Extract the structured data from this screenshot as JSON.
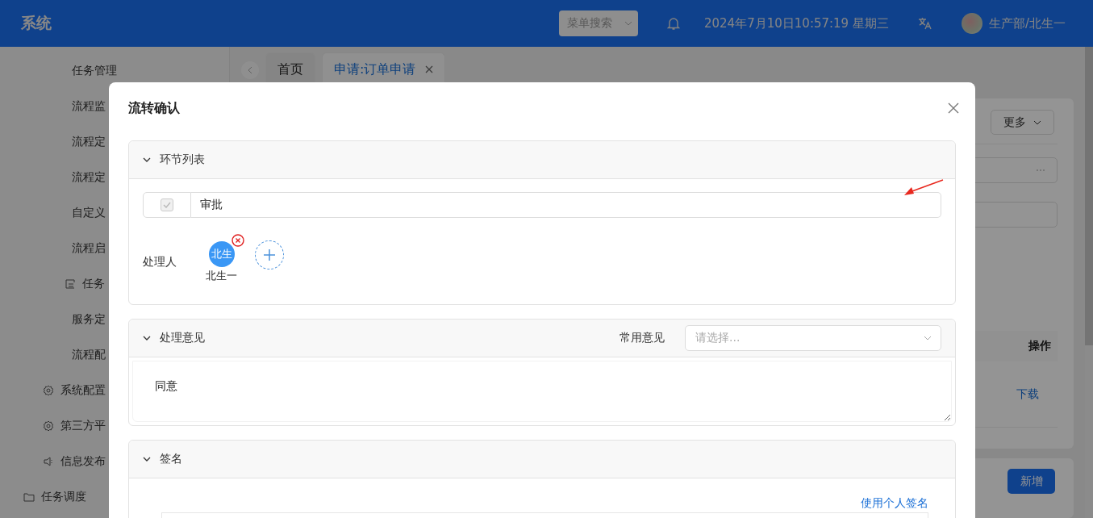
{
  "header": {
    "title": "系统",
    "menu_search": {
      "placeholder": "菜单搜索"
    },
    "datetime": "2024年7月10日10:57:19 星期三",
    "user": "生产部/北生一"
  },
  "sidebar": {
    "items": [
      {
        "label": "任务管理",
        "kind": "plain"
      },
      {
        "label": "流程监",
        "kind": "plain"
      },
      {
        "label": "流程定",
        "kind": "plain"
      },
      {
        "label": "流程定",
        "kind": "plain"
      },
      {
        "label": "自定义",
        "kind": "plain"
      },
      {
        "label": "流程启",
        "kind": "plain"
      },
      {
        "label": "任务",
        "kind": "list"
      },
      {
        "label": "服务定",
        "kind": "plain"
      },
      {
        "label": "流程配",
        "kind": "plain"
      },
      {
        "label": "系统配置",
        "kind": "gear"
      },
      {
        "label": "第三方平",
        "kind": "gear"
      },
      {
        "label": "信息发布",
        "kind": "speaker"
      },
      {
        "label": "任务调度",
        "kind": "folder"
      }
    ]
  },
  "tabs": [
    {
      "label": "首页",
      "selected": false,
      "closable": false
    },
    {
      "label": "申请:订单申请",
      "selected": true,
      "closable": true
    }
  ],
  "content": {
    "more_button": "更多",
    "table": {
      "action_header": "操作",
      "row_action": "下载"
    },
    "add_button": "新增"
  },
  "dialog": {
    "title": "流转确认",
    "sections": [
      {
        "kind": "steps",
        "title": "环节列表",
        "expanded": true,
        "steps": [
          {
            "label": "审批",
            "checked": true
          }
        ],
        "handler_label": "处理人",
        "handlers": [
          {
            "initials": "北生",
            "name": "北生一"
          }
        ]
      },
      {
        "kind": "opinion",
        "title": "处理意见",
        "expanded": true,
        "common_label": "常用意见",
        "common_select": {
          "placeholder": "请选择..."
        },
        "opinion": "同意"
      },
      {
        "kind": "signature",
        "title": "签名",
        "expanded": true,
        "link": "使用个人签名"
      }
    ]
  }
}
